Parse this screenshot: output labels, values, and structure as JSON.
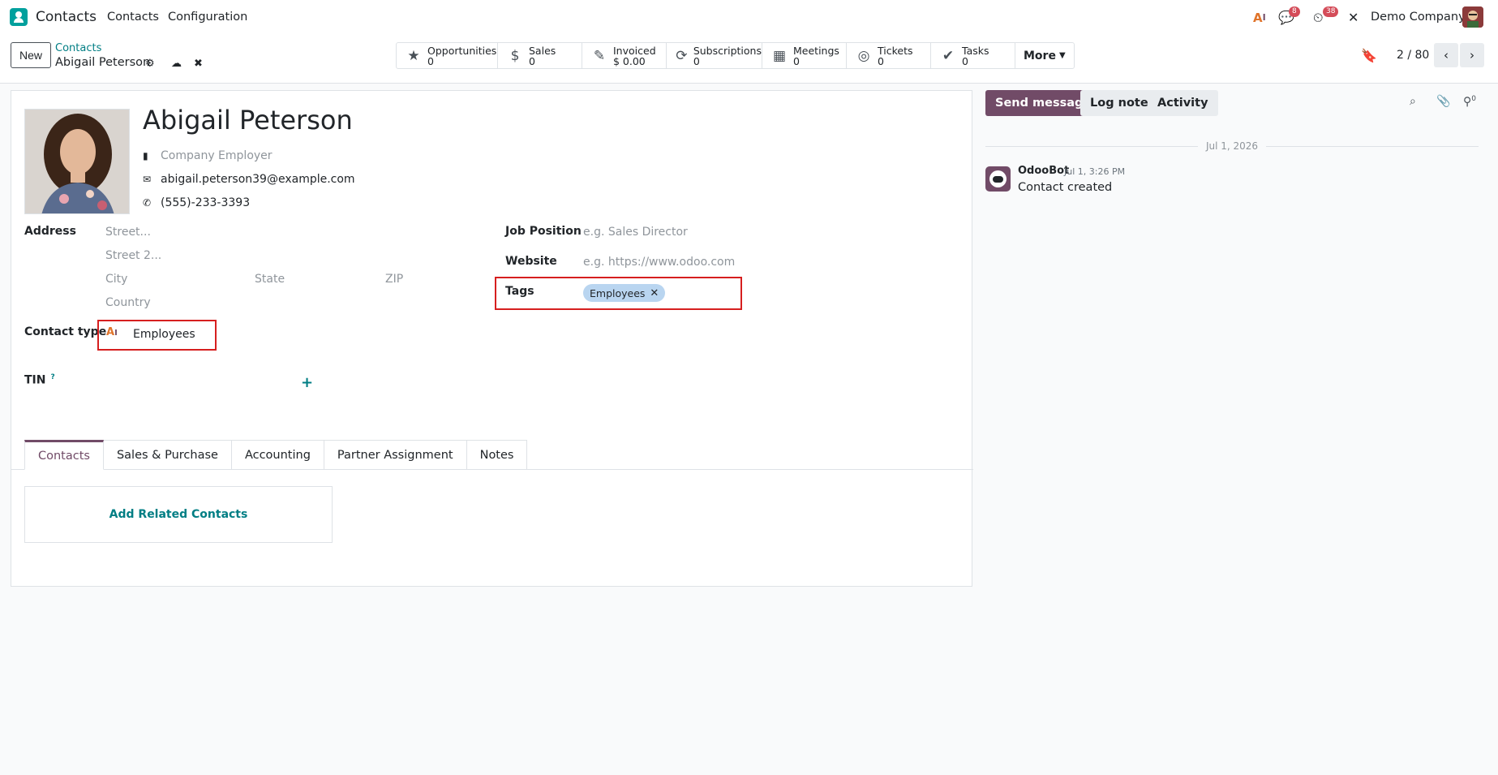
{
  "navbar": {
    "app_name": "Contacts",
    "menu": [
      "Contacts",
      "Configuration"
    ],
    "messages_count": "8",
    "activities_count": "38",
    "company": "Demo Company"
  },
  "control": {
    "new_label": "New",
    "breadcrumb": "Contacts",
    "record_title": "Abigail Peterson",
    "smart_buttons": [
      {
        "label": "Opportunities",
        "value": "0",
        "icon": "star-icon"
      },
      {
        "label": "Sales",
        "value": "0",
        "icon": "dollar-icon"
      },
      {
        "label": "Invoiced",
        "value": "$ 0.00",
        "icon": "invoice-icon"
      },
      {
        "label": "Subscriptions",
        "value": "0",
        "icon": "refresh-icon"
      },
      {
        "label": "Meetings",
        "value": "0",
        "icon": "calendar-icon"
      },
      {
        "label": "Tickets",
        "value": "0",
        "icon": "lifebuoy-icon"
      },
      {
        "label": "Tasks",
        "value": "0",
        "icon": "check-icon"
      }
    ],
    "more_label": "More",
    "pager": "2 / 80"
  },
  "form": {
    "name": "Abigail Peterson",
    "company_placeholder": "Company Employer",
    "email": "abigail.peterson39@example.com",
    "phone": "(555)-233-3393",
    "address_label": "Address",
    "street_ph": "Street...",
    "street2_ph": "Street 2...",
    "city_ph": "City",
    "state_ph": "State",
    "zip_ph": "ZIP",
    "country_ph": "Country",
    "contact_type_label": "Contact type",
    "contact_type_value": "Employees",
    "tin_label": "TIN",
    "tin_help": "?",
    "job_label": "Job Position",
    "job_ph": "e.g. Sales Director",
    "website_label": "Website",
    "website_ph": "e.g. https://www.odoo.com",
    "tags_label": "Tags",
    "tag": "Employees",
    "tabs": [
      "Contacts",
      "Sales & Purchase",
      "Accounting",
      "Partner Assignment",
      "Notes"
    ],
    "add_related": "Add Related Contacts"
  },
  "chatter": {
    "send_message": "Send message",
    "log_note": "Log note",
    "activity": "Activity",
    "followers_count": "0",
    "date": "Jul 1, 2026",
    "author": "OdooBot",
    "msg_date": "Jul 1, 3:26 PM",
    "body": "Contact created"
  },
  "colors": {
    "brand": "#714b67",
    "link": "#017e84",
    "highlight": "#d61f1f"
  }
}
